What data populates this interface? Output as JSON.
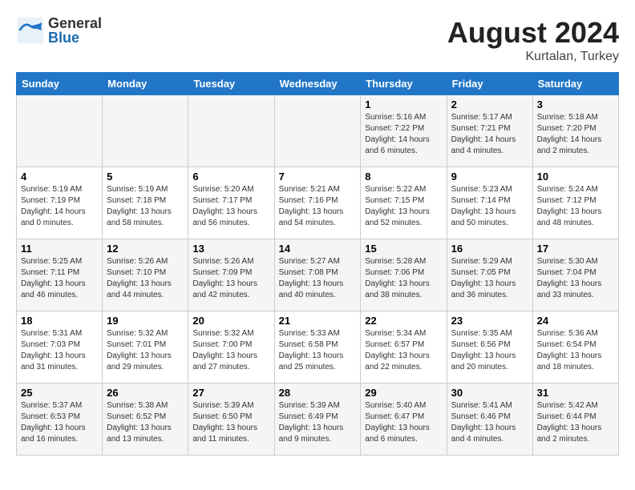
{
  "header": {
    "logo_general": "General",
    "logo_blue": "Blue",
    "month_year": "August 2024",
    "location": "Kurtalan, Turkey"
  },
  "weekdays": [
    "Sunday",
    "Monday",
    "Tuesday",
    "Wednesday",
    "Thursday",
    "Friday",
    "Saturday"
  ],
  "weeks": [
    [
      {
        "day": "",
        "info": ""
      },
      {
        "day": "",
        "info": ""
      },
      {
        "day": "",
        "info": ""
      },
      {
        "day": "",
        "info": ""
      },
      {
        "day": "1",
        "info": "Sunrise: 5:16 AM\nSunset: 7:22 PM\nDaylight: 14 hours\nand 6 minutes."
      },
      {
        "day": "2",
        "info": "Sunrise: 5:17 AM\nSunset: 7:21 PM\nDaylight: 14 hours\nand 4 minutes."
      },
      {
        "day": "3",
        "info": "Sunrise: 5:18 AM\nSunset: 7:20 PM\nDaylight: 14 hours\nand 2 minutes."
      }
    ],
    [
      {
        "day": "4",
        "info": "Sunrise: 5:19 AM\nSunset: 7:19 PM\nDaylight: 14 hours\nand 0 minutes."
      },
      {
        "day": "5",
        "info": "Sunrise: 5:19 AM\nSunset: 7:18 PM\nDaylight: 13 hours\nand 58 minutes."
      },
      {
        "day": "6",
        "info": "Sunrise: 5:20 AM\nSunset: 7:17 PM\nDaylight: 13 hours\nand 56 minutes."
      },
      {
        "day": "7",
        "info": "Sunrise: 5:21 AM\nSunset: 7:16 PM\nDaylight: 13 hours\nand 54 minutes."
      },
      {
        "day": "8",
        "info": "Sunrise: 5:22 AM\nSunset: 7:15 PM\nDaylight: 13 hours\nand 52 minutes."
      },
      {
        "day": "9",
        "info": "Sunrise: 5:23 AM\nSunset: 7:14 PM\nDaylight: 13 hours\nand 50 minutes."
      },
      {
        "day": "10",
        "info": "Sunrise: 5:24 AM\nSunset: 7:12 PM\nDaylight: 13 hours\nand 48 minutes."
      }
    ],
    [
      {
        "day": "11",
        "info": "Sunrise: 5:25 AM\nSunset: 7:11 PM\nDaylight: 13 hours\nand 46 minutes."
      },
      {
        "day": "12",
        "info": "Sunrise: 5:26 AM\nSunset: 7:10 PM\nDaylight: 13 hours\nand 44 minutes."
      },
      {
        "day": "13",
        "info": "Sunrise: 5:26 AM\nSunset: 7:09 PM\nDaylight: 13 hours\nand 42 minutes."
      },
      {
        "day": "14",
        "info": "Sunrise: 5:27 AM\nSunset: 7:08 PM\nDaylight: 13 hours\nand 40 minutes."
      },
      {
        "day": "15",
        "info": "Sunrise: 5:28 AM\nSunset: 7:06 PM\nDaylight: 13 hours\nand 38 minutes."
      },
      {
        "day": "16",
        "info": "Sunrise: 5:29 AM\nSunset: 7:05 PM\nDaylight: 13 hours\nand 36 minutes."
      },
      {
        "day": "17",
        "info": "Sunrise: 5:30 AM\nSunset: 7:04 PM\nDaylight: 13 hours\nand 33 minutes."
      }
    ],
    [
      {
        "day": "18",
        "info": "Sunrise: 5:31 AM\nSunset: 7:03 PM\nDaylight: 13 hours\nand 31 minutes."
      },
      {
        "day": "19",
        "info": "Sunrise: 5:32 AM\nSunset: 7:01 PM\nDaylight: 13 hours\nand 29 minutes."
      },
      {
        "day": "20",
        "info": "Sunrise: 5:32 AM\nSunset: 7:00 PM\nDaylight: 13 hours\nand 27 minutes."
      },
      {
        "day": "21",
        "info": "Sunrise: 5:33 AM\nSunset: 6:58 PM\nDaylight: 13 hours\nand 25 minutes."
      },
      {
        "day": "22",
        "info": "Sunrise: 5:34 AM\nSunset: 6:57 PM\nDaylight: 13 hours\nand 22 minutes."
      },
      {
        "day": "23",
        "info": "Sunrise: 5:35 AM\nSunset: 6:56 PM\nDaylight: 13 hours\nand 20 minutes."
      },
      {
        "day": "24",
        "info": "Sunrise: 5:36 AM\nSunset: 6:54 PM\nDaylight: 13 hours\nand 18 minutes."
      }
    ],
    [
      {
        "day": "25",
        "info": "Sunrise: 5:37 AM\nSunset: 6:53 PM\nDaylight: 13 hours\nand 16 minutes."
      },
      {
        "day": "26",
        "info": "Sunrise: 5:38 AM\nSunset: 6:52 PM\nDaylight: 13 hours\nand 13 minutes."
      },
      {
        "day": "27",
        "info": "Sunrise: 5:39 AM\nSunset: 6:50 PM\nDaylight: 13 hours\nand 11 minutes."
      },
      {
        "day": "28",
        "info": "Sunrise: 5:39 AM\nSunset: 6:49 PM\nDaylight: 13 hours\nand 9 minutes."
      },
      {
        "day": "29",
        "info": "Sunrise: 5:40 AM\nSunset: 6:47 PM\nDaylight: 13 hours\nand 6 minutes."
      },
      {
        "day": "30",
        "info": "Sunrise: 5:41 AM\nSunset: 6:46 PM\nDaylight: 13 hours\nand 4 minutes."
      },
      {
        "day": "31",
        "info": "Sunrise: 5:42 AM\nSunset: 6:44 PM\nDaylight: 13 hours\nand 2 minutes."
      }
    ]
  ]
}
